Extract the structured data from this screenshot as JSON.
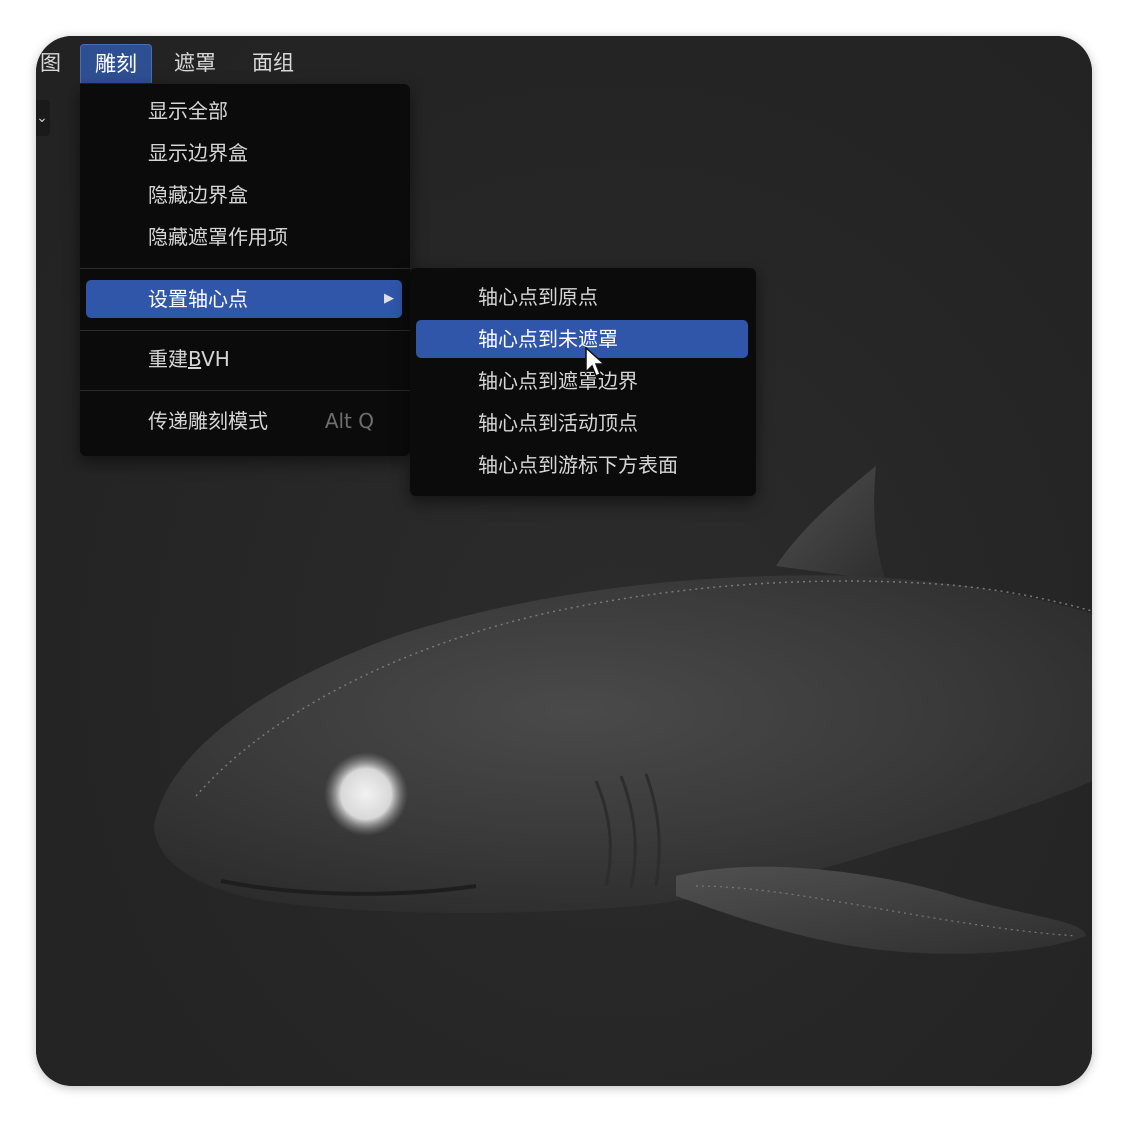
{
  "menubar": {
    "items": [
      {
        "label": "视图",
        "visible": "见图"
      },
      {
        "label": "雕刻"
      },
      {
        "label": "遮罩"
      },
      {
        "label": "面组"
      }
    ],
    "partial_first": "图"
  },
  "sculpt_menu": {
    "items": [
      {
        "label": "显示全部"
      },
      {
        "label": "显示边界盒"
      },
      {
        "label": "隐藏边界盒"
      },
      {
        "label": "隐藏遮罩作用项"
      },
      {
        "label": "设置轴心点"
      },
      {
        "label_prefix": "重建",
        "label_underlined": "B",
        "label_suffix": "VH"
      },
      {
        "label": "传递雕刻模式",
        "shortcut": "Alt Q"
      }
    ]
  },
  "pivot_submenu": {
    "items": [
      {
        "label": "轴心点到原点"
      },
      {
        "label": "轴心点到未遮罩"
      },
      {
        "label": "轴心点到遮罩边界"
      },
      {
        "label": "轴心点到活动顶点"
      },
      {
        "label": "轴心点到游标下方表面"
      }
    ]
  },
  "icons": {
    "submenu_arrow": "triangle-right-icon",
    "cursor": "mouse-pointer-icon",
    "side_toggle": "chevron-down-icon"
  },
  "colors": {
    "accent": "#2f56a8",
    "menu_bg": "#0b0b0b",
    "viewport_bg": "#262626",
    "text": "#d6d6d6"
  }
}
